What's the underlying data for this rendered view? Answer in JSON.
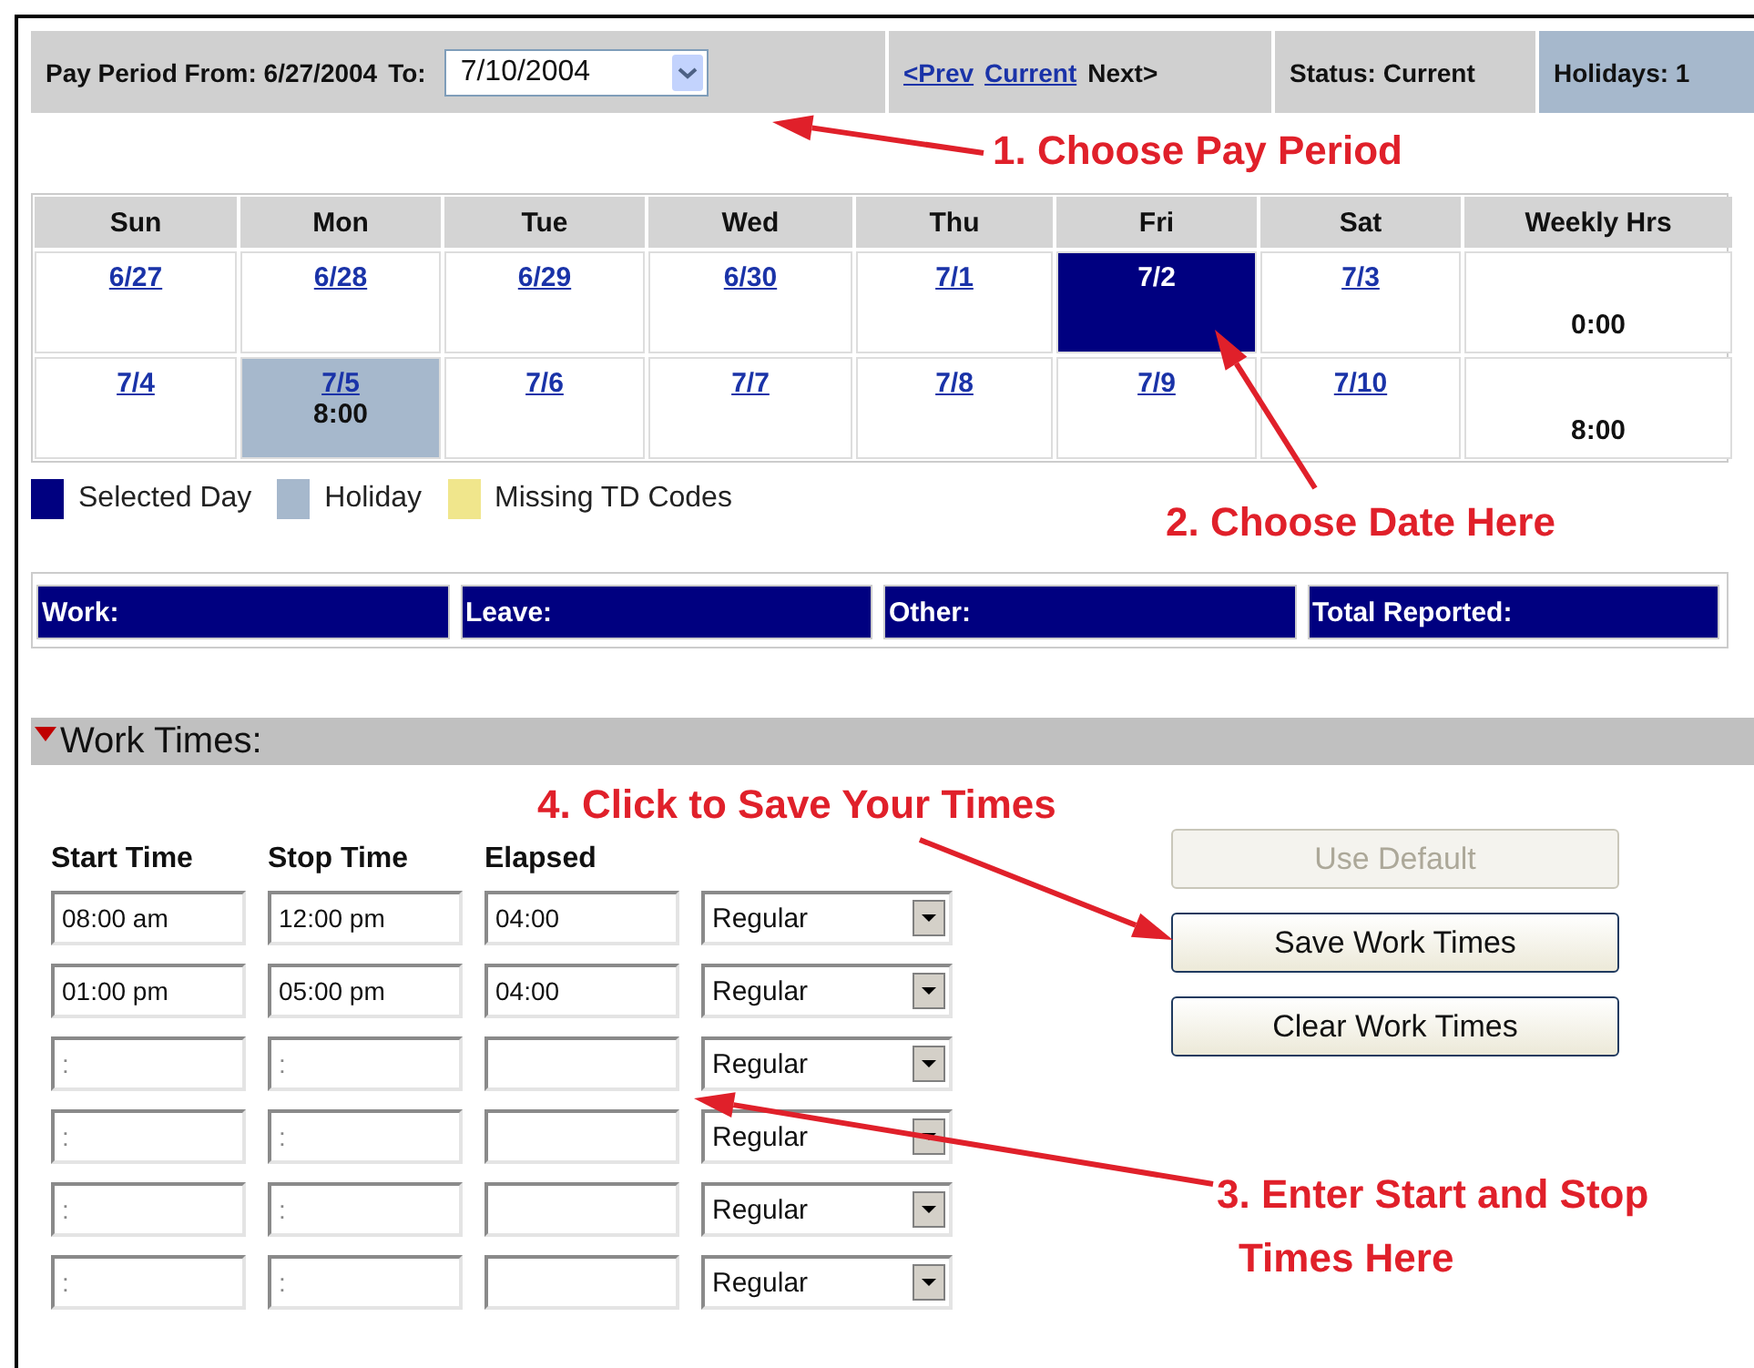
{
  "pay_period": {
    "from_label": "Pay Period From: 6/27/2004",
    "to_label": "To:",
    "to_select": {
      "value": "7/10/2004"
    }
  },
  "navigation": [
    {
      "label": "<Prev",
      "kind": "link"
    },
    {
      "label": "Current",
      "kind": "link"
    },
    {
      "label": "Next>",
      "kind": "text"
    }
  ],
  "status": "Status: Current",
  "holidays": "Holidays: 1",
  "calendar": {
    "columns": [
      "Sun",
      "Mon",
      "Tue",
      "Wed",
      "Thu",
      "Fri",
      "Sat",
      "Weekly Hrs"
    ],
    "weeks": [
      {
        "days": [
          {
            "date": "6/27",
            "selected": false,
            "holiday": false
          },
          {
            "date": "6/28",
            "selected": false,
            "holiday": false
          },
          {
            "date": "6/29",
            "selected": false,
            "holiday": false
          },
          {
            "date": "6/30",
            "selected": false,
            "holiday": false
          },
          {
            "date": "7/1",
            "selected": false,
            "holiday": false
          },
          {
            "date": "7/2",
            "selected": true,
            "holiday": false
          },
          {
            "date": "7/3",
            "selected": false,
            "holiday": false
          }
        ],
        "weekly_hours": "0:00"
      },
      {
        "days": [
          {
            "date": "7/4",
            "selected": false,
            "holiday": false
          },
          {
            "date": "7/5",
            "selected": false,
            "holiday": true,
            "hours": "8:00"
          },
          {
            "date": "7/6",
            "selected": false,
            "holiday": false
          },
          {
            "date": "7/7",
            "selected": false,
            "holiday": false
          },
          {
            "date": "7/8",
            "selected": false,
            "holiday": false
          },
          {
            "date": "7/9",
            "selected": false,
            "holiday": false
          },
          {
            "date": "7/10",
            "selected": false,
            "holiday": false
          }
        ],
        "weekly_hours": "8:00"
      }
    ]
  },
  "legend": [
    {
      "label": "Selected Day",
      "color": "#000080"
    },
    {
      "label": "Holiday",
      "color": "#a6b8cc"
    },
    {
      "label": "Missing TD Codes",
      "color": "#f0e68c"
    }
  ],
  "totals": [
    "Work:",
    "Leave:",
    "Other:",
    "Total Reported:"
  ],
  "work_times": {
    "title": "Work Times:",
    "expanded": true,
    "columns": [
      "Start Time",
      "Stop Time",
      "Elapsed"
    ],
    "rows": [
      {
        "start": {
          "value": "08:00 am"
        },
        "stop": {
          "value": "12:00 pm"
        },
        "elapsed": {
          "value": "04:00"
        },
        "type": "Regular"
      },
      {
        "start": {
          "value": "01:00 pm"
        },
        "stop": {
          "value": "05:00 pm"
        },
        "elapsed": {
          "value": "04:00"
        },
        "type": "Regular"
      },
      {
        "start": {
          "placeholder": ":"
        },
        "stop": {
          "placeholder": ":"
        },
        "elapsed": {},
        "type": "Regular"
      },
      {
        "start": {
          "placeholder": ":"
        },
        "stop": {
          "placeholder": ":"
        },
        "elapsed": {},
        "type": "Regular"
      },
      {
        "start": {
          "placeholder": ":"
        },
        "stop": {
          "placeholder": ":"
        },
        "elapsed": {},
        "type": "Regular"
      },
      {
        "start": {
          "placeholder": ":"
        },
        "stop": {
          "placeholder": ":"
        },
        "elapsed": {},
        "type": "Regular"
      }
    ]
  },
  "buttons": [
    {
      "label": "Use Default",
      "disabled": true
    },
    {
      "label": "Save Work Times",
      "disabled": false
    },
    {
      "label": "Clear Work Times",
      "disabled": false
    }
  ],
  "annotations": [
    {
      "lines": [
        "1. Choose Pay Period"
      ]
    },
    {
      "lines": [
        "2. Choose Date Here"
      ]
    },
    {
      "lines": [
        "3. Enter Start and Stop",
        "Times Here"
      ]
    },
    {
      "lines": [
        "4. Click to Save Your Times"
      ]
    }
  ]
}
